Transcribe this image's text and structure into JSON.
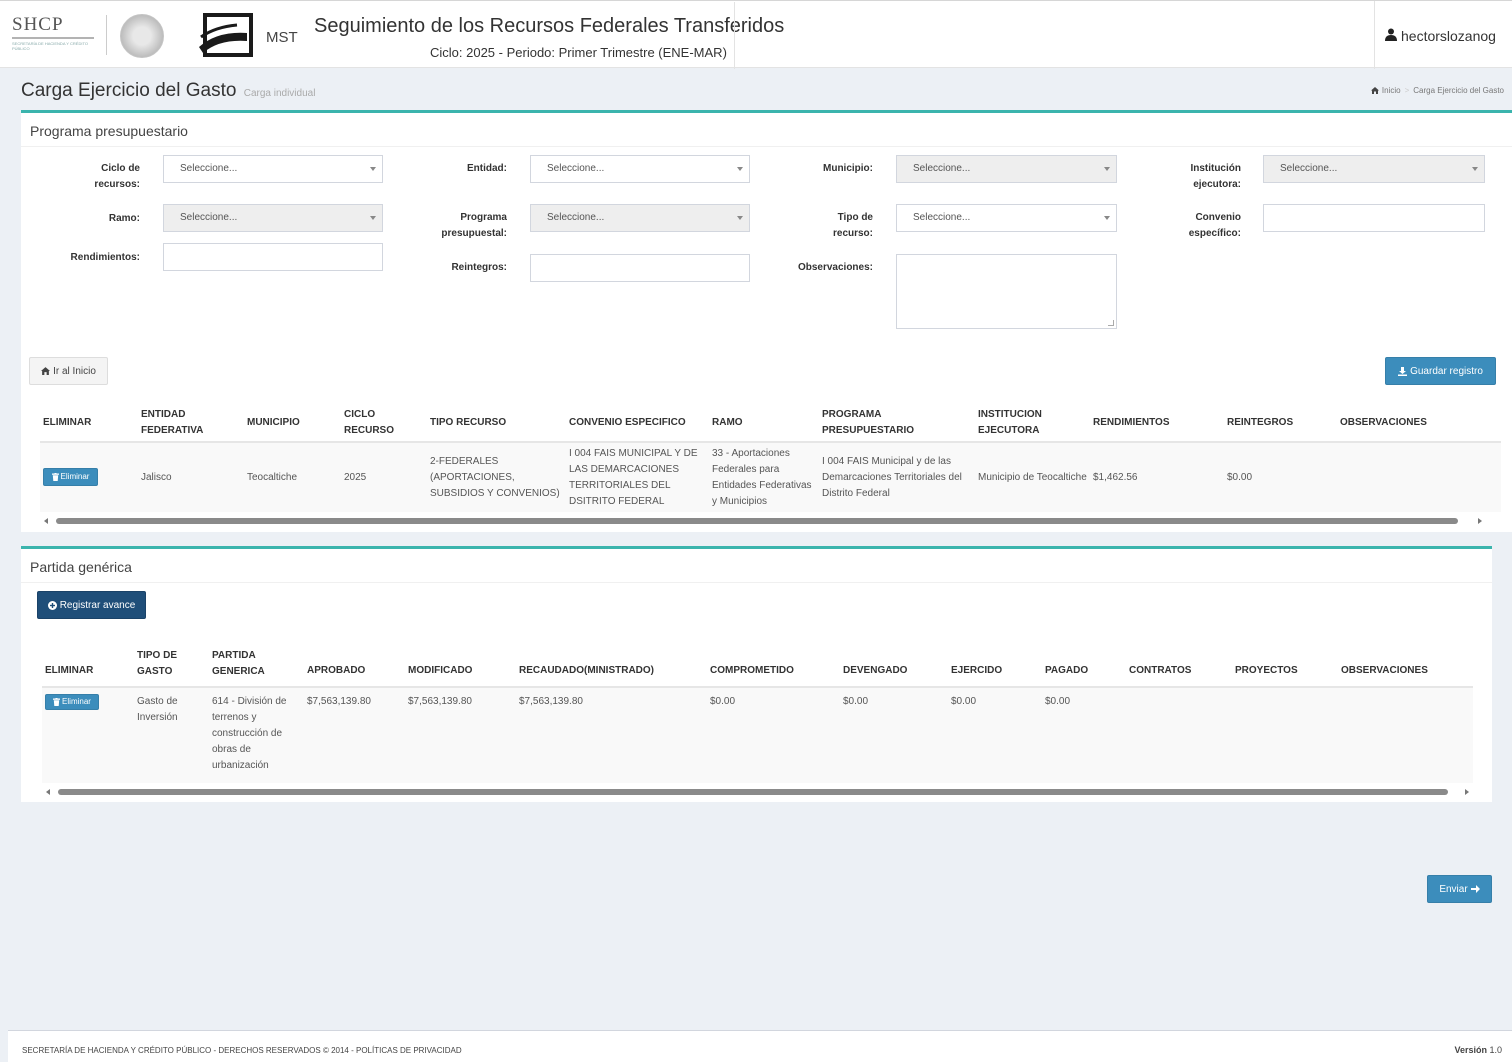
{
  "header": {
    "org_short": "SHCP",
    "org_sub": "SECRETARÍA DE HACIENDA Y CRÉDITO PÚBLICO",
    "mst_label": "MST",
    "app_title": "Seguimiento de los Recursos Federales Transferidos",
    "app_subtitle": "Ciclo: 2025 - Periodo: Primer Trimestre (ENE-MAR)",
    "username": "hectorslozanog"
  },
  "page": {
    "title": "Carga Ejercicio del Gasto",
    "subtitle": "Carga individual",
    "breadcrumb": [
      "Inicio",
      "Carga Ejercicio del Gasto"
    ]
  },
  "programa": {
    "title": "Programa presupuestario",
    "fields": {
      "ciclo_label": "Ciclo de recursos:",
      "ciclo_value": "Seleccione...",
      "entidad_label": "Entidad:",
      "entidad_value": "Seleccione...",
      "municipio_label": "Municipio:",
      "municipio_value": "Seleccione...",
      "institucion_label": "Institución ejecutora:",
      "institucion_value": "Seleccione...",
      "ramo_label": "Ramo:",
      "ramo_value": "Seleccione...",
      "programa_label": "Programa presupuestal:",
      "programa_value": "Seleccione...",
      "tipo_label": "Tipo de recurso:",
      "tipo_value": "Seleccione...",
      "convenio_label": "Convenio específico:",
      "rendimientos_label": "Rendimientos:",
      "reintegros_label": "Reintegros:",
      "observaciones_label": "Observaciones:"
    },
    "btn_inicio": "Ir al Inicio",
    "btn_guardar": "Guardar registro",
    "table": {
      "headers": [
        "ELIMINAR",
        "ENTIDAD FEDERATIVA",
        "MUNICIPIO",
        "CICLO RECURSO",
        "TIPO RECURSO",
        "CONVENIO ESPECIFICO",
        "RAMO",
        "PROGRAMA PRESUPUESTARIO",
        "INSTITUCION EJECUTORA",
        "RENDIMIENTOS",
        "REINTEGROS",
        "OBSERVACIONES"
      ],
      "row": {
        "eliminar": "Eliminar",
        "entidad": "Jalisco",
        "municipio": "Teocaltiche",
        "ciclo": "2025",
        "tipo": "2-FEDERALES (APORTACIONES, SUBSIDIOS Y CONVENIOS)",
        "convenio": "I 004 FAIS MUNICIPAL Y DE LAS DEMARCACIONES TERRITORIALES DEL DSITRITO FEDERAL",
        "ramo": "33 - Aportaciones Federales para Entidades Federativas y Municipios",
        "programa": "I 004 FAIS Municipal y de las Demarcaciones Territoriales del Distrito Federal",
        "institucion": "Municipio de Teocaltiche",
        "rendimientos": "$1,462.56",
        "reintegros": "$0.00",
        "observaciones": ""
      }
    }
  },
  "partida": {
    "title": "Partida genérica",
    "btn_registrar": "Registrar avance",
    "table": {
      "headers": [
        "ELIMINAR",
        "TIPO DE GASTO",
        "PARTIDA GENERICA",
        "APROBADO",
        "MODIFICADO",
        "RECAUDADO(MINISTRADO)",
        "COMPROMETIDO",
        "DEVENGADO",
        "EJERCIDO",
        "PAGADO",
        "CONTRATOS",
        "PROYECTOS",
        "OBSERVACIONES"
      ],
      "row": {
        "eliminar": "Eliminar",
        "tipo_gasto": "Gasto de Inversión",
        "partida": "614 - División de terrenos y construcción de obras de urbanización",
        "aprobado": "$7,563,139.80",
        "modificado": "$7,563,139.80",
        "recaudado": "$7,563,139.80",
        "comprometido": "$0.00",
        "devengado": "$0.00",
        "ejercido": "$0.00",
        "pagado": "$0.00",
        "contratos": "",
        "proyectos": "",
        "observaciones": ""
      }
    }
  },
  "btn_enviar": "Enviar",
  "footer": {
    "text": "SECRETARÍA DE HACIENDA Y CRÉDITO PÚBLICO - DERECHOS RESERVADOS © 2014 - POLÍTICAS DE PRIVACIDAD",
    "version_label": "Versión",
    "version_value": "1.0"
  },
  "colors": {
    "accent": "#3bb4ad",
    "primary": "#3c8dbc",
    "dark_button": "#1f4e79",
    "background": "#ecf0f5"
  }
}
